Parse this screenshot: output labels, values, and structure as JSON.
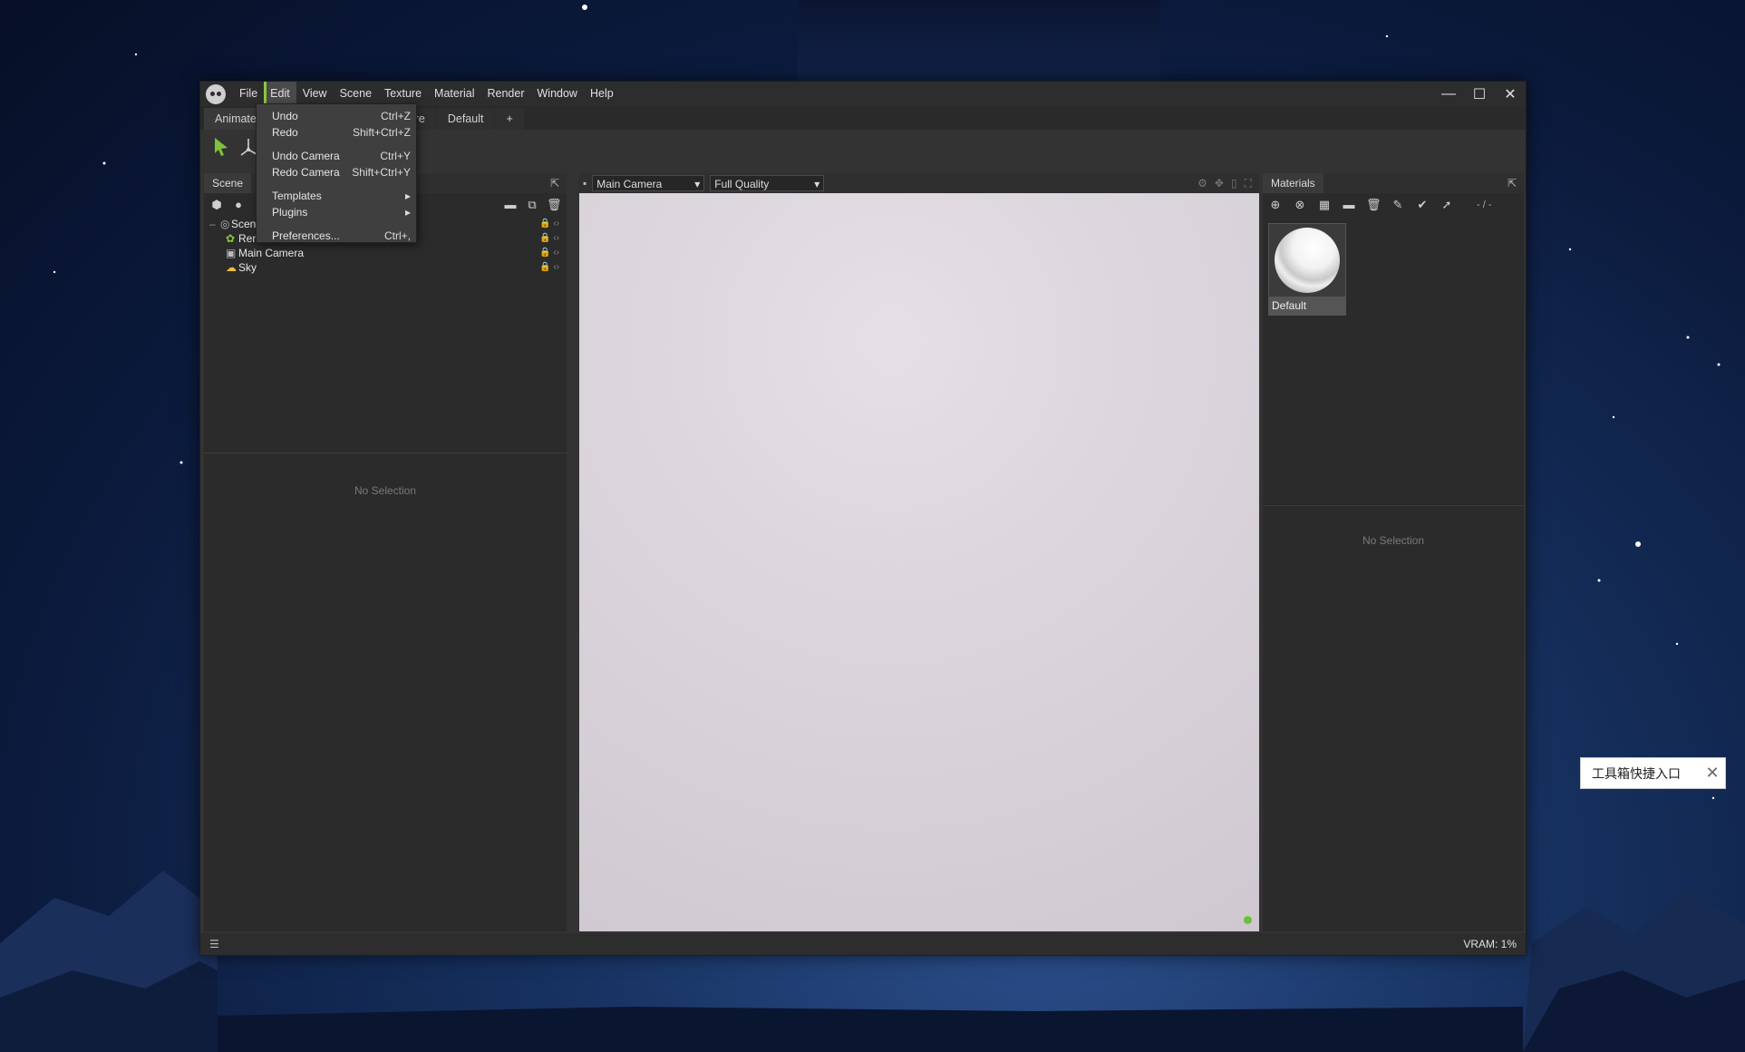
{
  "window": {
    "menu": [
      "File",
      "Edit",
      "View",
      "Scene",
      "Texture",
      "Material",
      "Render",
      "Window",
      "Help"
    ],
    "controls": {
      "minimize": "—",
      "maximize": "☐",
      "close": "✕"
    }
  },
  "tabs": [
    "Animate",
    "Texture",
    "Default",
    "+"
  ],
  "edit_menu": {
    "undo": {
      "label": "Undo",
      "shortcut": "Ctrl+Z"
    },
    "redo": {
      "label": "Redo",
      "shortcut": "Shift+Ctrl+Z"
    },
    "undo_camera": {
      "label": "Undo Camera",
      "shortcut": "Ctrl+Y"
    },
    "redo_camera": {
      "label": "Redo Camera",
      "shortcut": "Shift+Ctrl+Y"
    },
    "templates": {
      "label": "Templates",
      "arrow": "▸"
    },
    "plugins": {
      "label": "Plugins",
      "arrow": "▸"
    },
    "preferences": {
      "label": "Preferences...",
      "shortcut": "Ctrl+,"
    }
  },
  "scene_panel": {
    "tab": "Scene",
    "tree": [
      {
        "label": "Scene"
      },
      {
        "label": "Render"
      },
      {
        "label": "Main Camera"
      },
      {
        "label": "Sky"
      }
    ],
    "no_selection": "No Selection"
  },
  "viewport": {
    "camera": "Main Camera",
    "quality": "Full Quality",
    "arrow": "▾"
  },
  "materials_panel": {
    "tab": "Materials",
    "counter": "- / -",
    "material_name": "Default",
    "no_selection": "No Selection"
  },
  "status": {
    "vram": "VRAM: 1%"
  },
  "toast": {
    "text": "工具箱快捷入口",
    "close": "✕"
  }
}
